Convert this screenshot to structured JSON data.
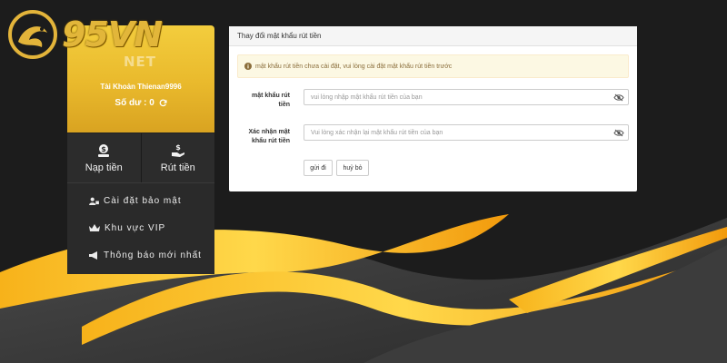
{
  "brand": {
    "logo_text": "95VN",
    "ghost_text": "NET"
  },
  "account": {
    "name": "Tài Khoản Thienan9996",
    "balance_label": "Số dư :",
    "balance_value": "0"
  },
  "actions": [
    {
      "label": "Nạp tiền",
      "icon": "deposit-money-icon"
    },
    {
      "label": "Rút tiền",
      "icon": "withdraw-money-icon"
    }
  ],
  "menu": [
    {
      "label": "Cài đặt bảo mật",
      "icon": "user-lock-icon"
    },
    {
      "label": "Khu vực VIP",
      "icon": "crown-icon"
    },
    {
      "label": "Thông báo mới nhất",
      "icon": "megaphone-icon"
    }
  ],
  "panel": {
    "title": "Thay đổi mật khẩu rút tiền",
    "alert": "mật khẩu rút tiền chưa cài đặt, vui lòng cài đặt mật khẩu rút tiền trước",
    "fields": [
      {
        "label_line1": "mật khẩu rút",
        "label_line2": "tiền",
        "placeholder": "vui lòng nhập mật khẩu rút tiền của bạn"
      },
      {
        "label_line1": "Xác nhận mật",
        "label_line2": "khẩu rút tiền",
        "placeholder": "Vui lòng xác nhận lại mật khẩu rút tiền của bạn"
      }
    ],
    "submit_label": "gửi đi",
    "cancel_label": "huỷ bỏ"
  },
  "colors": {
    "gold": "#e9b92c",
    "panel_bg": "#ffffff",
    "sidebar_dark": "#2c2c2c",
    "alert_bg": "#fcf8e3"
  }
}
